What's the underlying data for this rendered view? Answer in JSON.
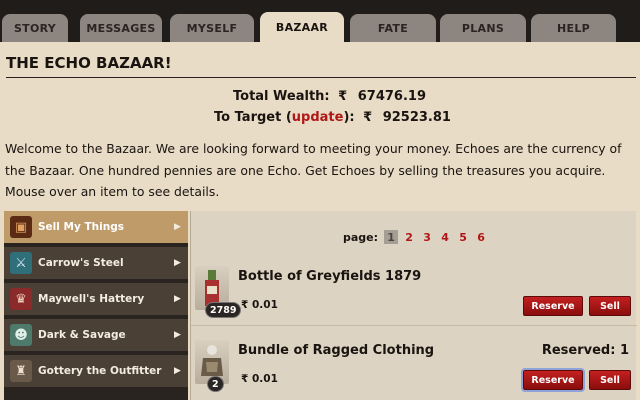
{
  "tabs": [
    {
      "label": "STORY"
    },
    {
      "label": "MESSAGES"
    },
    {
      "label": "MYSELF"
    },
    {
      "label": "BAZAAR",
      "active": true
    },
    {
      "label": "FATE"
    },
    {
      "label": "PLANS"
    },
    {
      "label": "HELP"
    }
  ],
  "page": {
    "title": "THE ECHO BAZAAR!",
    "total_wealth_label": "Total Wealth:",
    "total_wealth_value": "67476.19",
    "target_label_pre": "To Target (",
    "target_update_link": "update",
    "target_label_post": "):",
    "target_value": "92523.81",
    "currency_symbol": "₹",
    "intro": "Welcome to the Bazaar. We are looking forward to meeting your money. Echoes are the currency of the Bazaar. One hundred pennies are one Echo. Get Echoes by selling the treasures you acquire. Mouse over an item to see details."
  },
  "sidebar": {
    "items": [
      {
        "label": "Sell My Things",
        "icon": "crate-icon",
        "active": true
      },
      {
        "label": "Carrow's Steel",
        "icon": "sword-icon"
      },
      {
        "label": "Maywell's Hattery",
        "icon": "hat-icon"
      },
      {
        "label": "Dark & Savage",
        "icon": "mask-icon"
      },
      {
        "label": "Gottery the Outfitter",
        "icon": "outfit-icon"
      }
    ]
  },
  "pager": {
    "label": "page:",
    "pages": [
      "1",
      "2",
      "3",
      "4",
      "5",
      "6"
    ],
    "current": "1"
  },
  "listing": [
    {
      "name": "Bottle of Greyfields 1879",
      "quantity": "2789",
      "price": "0.01",
      "reserved": "",
      "reserve_label": "Reserve",
      "sell_label": "Sell"
    },
    {
      "name": "Bundle of Ragged Clothing",
      "quantity": "2",
      "price": "0.01",
      "reserved": "Reserved: 1",
      "reserve_label": "Reserve",
      "sell_label": "Sell"
    }
  ],
  "colors": {
    "background": "#e8dcc6",
    "tab_bar": "#201c1a",
    "accent_red": "#b01818",
    "sidebar_active": "#c09b6a"
  }
}
